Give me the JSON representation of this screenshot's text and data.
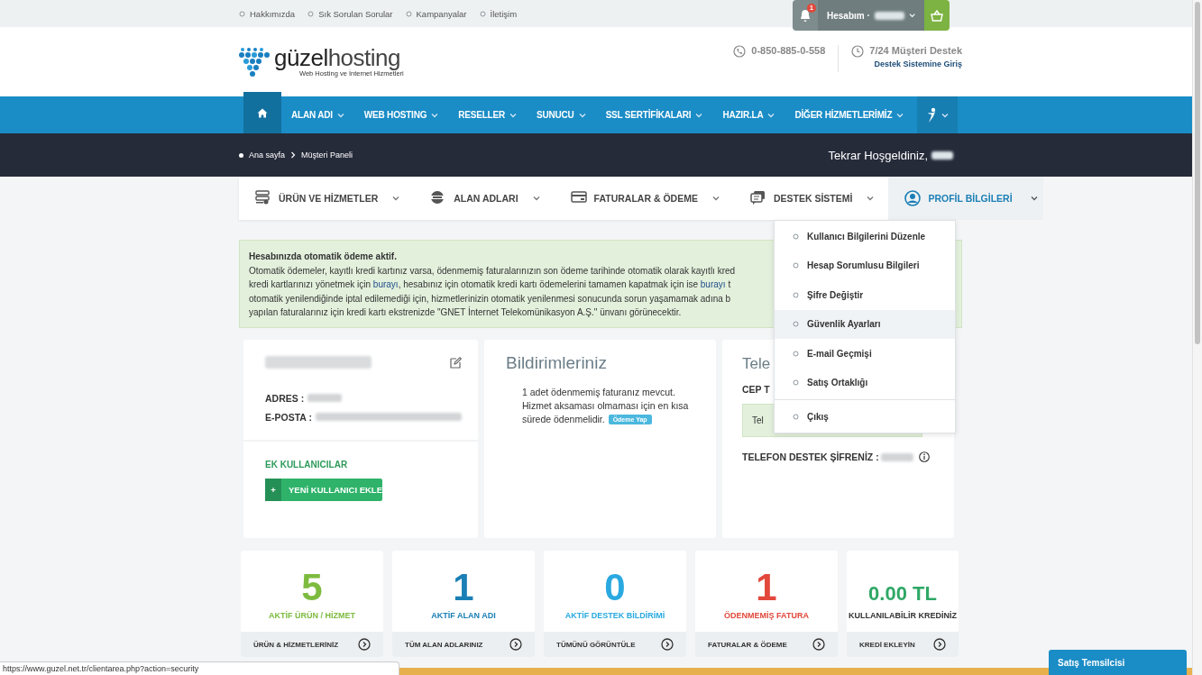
{
  "top_links": [
    "Hakkımızda",
    "Sık Sorulan Sorular",
    "Kampanyalar",
    "İletişim"
  ],
  "account": {
    "notification_count": "1",
    "label": "Hesabım ·"
  },
  "logo": {
    "name_first": "güzel",
    "name_second": "hosting",
    "tagline": "Web Hosting ve İnternet Hizmetleri"
  },
  "contact": {
    "phone": "0-850-885-0-558",
    "support_title": "7/24 Müşteri Destek",
    "support_link": "Destek Sistemine Giriş"
  },
  "nav": [
    {
      "label": "ALAN ADI"
    },
    {
      "label": "WEB HOSTING"
    },
    {
      "label": "RESELLER"
    },
    {
      "label": "SUNUCU"
    },
    {
      "label": "SSL SERTİFİKALARI"
    },
    {
      "label": "HAZIR.LA"
    },
    {
      "label": "DİĞER HİZMETLERİMİZ"
    }
  ],
  "breadcrumb": [
    "Ana sayfa",
    "Müşteri Paneli"
  ],
  "welcome": "Tekrar Hoşgeldiniz,",
  "panel_tabs": [
    {
      "label": "ÜRÜN VE HİZMETLER",
      "kind": "server",
      "selected": false
    },
    {
      "label": "ALAN ADLARI",
      "kind": "www",
      "selected": false
    },
    {
      "label": "FATURALAR & ÖDEME",
      "kind": "card",
      "selected": false
    },
    {
      "label": "DESTEK SİSTEMİ",
      "kind": "chat",
      "selected": false
    },
    {
      "label": "PROFİL BİLGİLERİ",
      "kind": "user",
      "selected": true
    }
  ],
  "profile_menu": {
    "expanded": true,
    "items": [
      {
        "label": "Kullanıcı Bilgilerini Düzenle",
        "selected": false
      },
      {
        "label": "Hesap Sorumlusu Bilgileri",
        "selected": false
      },
      {
        "label": "Şifre Değiştir",
        "selected": false
      },
      {
        "label": "Güvenlik Ayarları",
        "selected": true
      },
      {
        "label": "E-mail Geçmişi",
        "selected": false
      },
      {
        "label": "Satış Ortaklığı",
        "selected": false
      }
    ],
    "logout": "Çıkış"
  },
  "alert": {
    "title": "Hesabınızda otomatik ödeme aktif.",
    "lines": [
      [
        {
          "text": "Otomatik ödemeler, kayıtlı kredi kartınız varsa, ödenmemiş faturalarınızın son ödeme tarihinde otomatik olarak kayıtlı kred",
          "link": false
        }
      ],
      [
        {
          "text": "kredi kartlarınızı yönetmek için",
          "link": false
        },
        {
          "text": "burayı",
          "link": true
        },
        {
          "text": ", hesabınız için otomatik kredi kartı ödemelerini tamamen kapatmak için ise",
          "link": false
        },
        {
          "text": "burayı",
          "link": true
        },
        {
          "text": "t",
          "link": false
        }
      ],
      [
        {
          "text": "otomatik yenilendiğinde iptal edilemediği için, hizmetlerinizin otomatik yenilenmesi sonucunda sorun yaşamamak adına b",
          "link": false
        }
      ],
      [
        {
          "text": "yapılan faturalarınız için kredi kartı ekstrenizde \"GNET İnternet Telekomünikasyon A.Ş.\" ünvanı görünecektir.",
          "link": false
        }
      ]
    ]
  },
  "profile_card": {
    "fields": [
      {
        "label": "ADRES :"
      },
      {
        "label": "E-POSTA :"
      }
    ],
    "extra_users_title": "EK KULLANICILAR",
    "add_icon": "+",
    "add_button": "YENİ KULLANICI EKLE"
  },
  "notifications": {
    "title": "Bildirimleriniz",
    "message": "1 adet ödenmemiş faturanız mevcut. Hizmet aksaması olmaması için en kısa",
    "message_end": "sürede ödenmelidir.",
    "pay_button": "Ödeme Yap"
  },
  "phone_card": {
    "title": "Tele",
    "mobile_label": "CEP T",
    "notice": "Tel",
    "password_label": "TELEFON DESTEK ŞİFRENİZ :"
  },
  "stats": [
    {
      "value": "5",
      "label": "AKTİF ÜRÜN / HİZMET",
      "color": "#7dbb3f",
      "label_colored": true,
      "link": "ÜRÜN & HİZMETLERİNİZ"
    },
    {
      "value": "1",
      "label": "AKTİF ALAN ADI",
      "color": "#1a7fb5",
      "label_colored": true,
      "link": "TÜM ALAN ADLARINIZ"
    },
    {
      "value": "0",
      "label": "AKTİF DESTEK BİLDİRİMİ",
      "color": "#2aa9e0",
      "label_colored": true,
      "link": "TÜMÜNÜ GÖRÜNTÜLE"
    },
    {
      "value": "1",
      "label": "ÖDENMEMİŞ FATURA",
      "color": "#e2483b",
      "label_colored": true,
      "link": "FATURALAR & ÖDEME"
    },
    {
      "value": "0.00 TL",
      "label": "KULLANILABİLİR KREDİNİZ",
      "color": "#2fa866",
      "label_colored": false,
      "link": "KREDİ EKLEYİN"
    }
  ],
  "status_url": "https://www.guzel.net.tr/clientarea.php?action=security",
  "chat_button": "Satış Temsilcisi"
}
